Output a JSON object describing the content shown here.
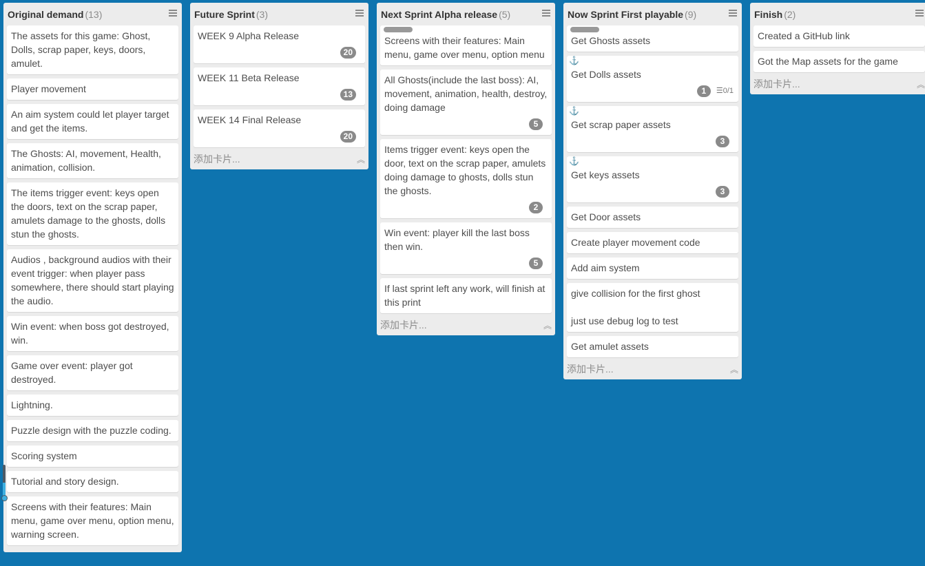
{
  "add_card": "添加卡片...",
  "lists": [
    {
      "title": "Original demand",
      "count": "(13)",
      "cards": [
        {
          "text": "The assets for this game: Ghost, Dolls, scrap paper, keys, doors, amulet."
        },
        {
          "text": "Player movement"
        },
        {
          "text": "An aim system could let player target and get the items."
        },
        {
          "text": "The Ghosts: AI, movement, Health, animation, collision."
        },
        {
          "text": "The items trigger event: keys open the doors, text on the scrap paper, amulets damage to the ghosts, dolls stun the ghosts."
        },
        {
          "text": "Audios , background audios with their event trigger: when player pass somewhere, there should start playing the audio."
        },
        {
          "text": "Win event: when boss got destroyed, win."
        },
        {
          "text": "Game over event: player got destroyed."
        },
        {
          "text": "Lightning."
        },
        {
          "text": "Puzzle design with the puzzle coding."
        },
        {
          "text": "Scoring system"
        },
        {
          "text": "Tutorial and story design."
        },
        {
          "text": "Screens with their features: Main menu, game over menu, option menu, warning screen."
        }
      ]
    },
    {
      "title": "Future Sprint",
      "count": "(3)",
      "cards": [
        {
          "text": "WEEK 9 Alpha Release",
          "badge": "20"
        },
        {
          "text": "WEEK 11 Beta Release",
          "badge": "13"
        },
        {
          "text": "WEEK 14 Final Release",
          "badge": "20"
        }
      ]
    },
    {
      "title": "Next Sprint Alpha release",
      "count": "(5)",
      "cards": [
        {
          "text": "Screens with their features: Main menu, game over menu, option menu",
          "label": true
        },
        {
          "text": "All Ghosts(include the last boss): AI, movement, animation, health, destroy, doing damage",
          "badge": "5"
        },
        {
          "text": "Items trigger event: keys open the door, text on the scrap paper, amulets doing damage to ghosts, dolls stun the ghosts.",
          "badge": "2"
        },
        {
          "text": "Win event: player kill the last boss then win.",
          "badge": "5"
        },
        {
          "text": "If last sprint left any work, will finish at this print"
        }
      ]
    },
    {
      "title": "Now Sprint First playable",
      "count": "(9)",
      "cards": [
        {
          "text": "Get Ghosts assets",
          "label": true
        },
        {
          "text": "Get Dolls assets",
          "anchor": true,
          "badge": "1",
          "checklist": "0/1"
        },
        {
          "text": "Get scrap paper assets",
          "anchor": true,
          "badge": "3"
        },
        {
          "text": "Get keys assets",
          "anchor": true,
          "badge": "3"
        },
        {
          "text": "Get Door assets"
        },
        {
          "text": "Create player movement code"
        },
        {
          "text": "Add aim system"
        },
        {
          "text": "give collision for the first ghost\n\njust use debug log to test"
        },
        {
          "text": "Get amulet assets"
        }
      ]
    },
    {
      "title": "Finish",
      "count": "(2)",
      "cards": [
        {
          "text": "Created a GitHub link"
        },
        {
          "text": "Got the Map assets for the game"
        }
      ]
    }
  ]
}
